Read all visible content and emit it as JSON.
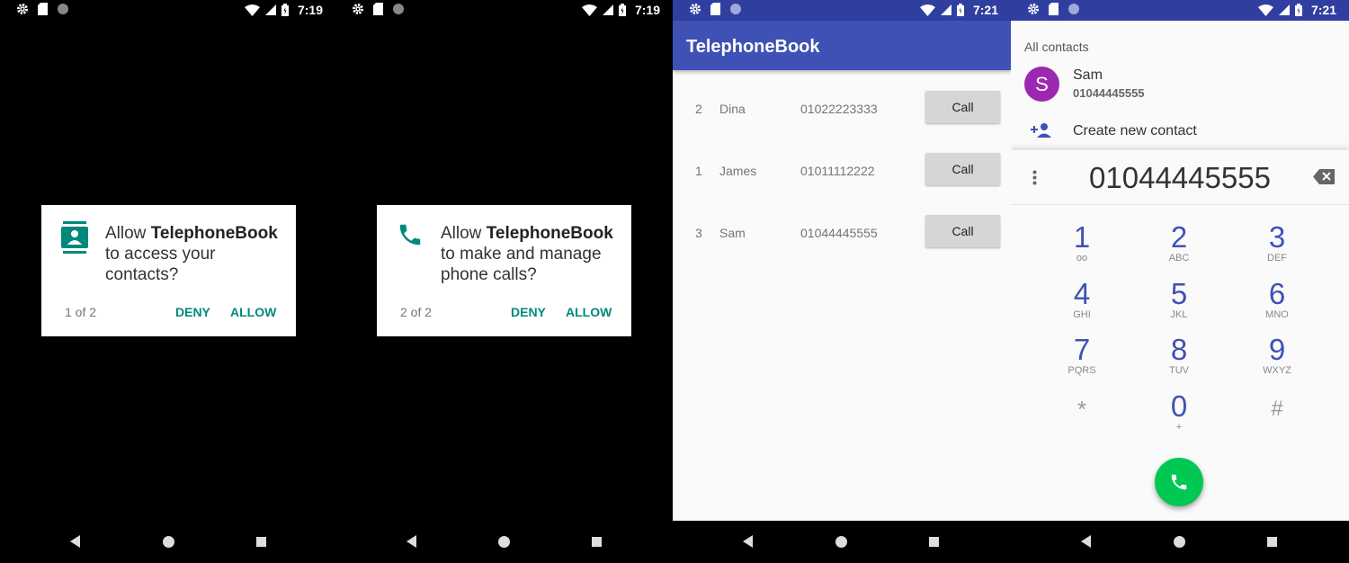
{
  "screen1": {
    "status_time": "7:19",
    "dialog": {
      "line1_prefix": "Allow ",
      "app_name": "TelephoneBook",
      "line2": "to access your",
      "line3": "contacts?",
      "counter": "1 of 2",
      "deny_label": "DENY",
      "allow_label": "ALLOW",
      "icon": "contacts-icon"
    }
  },
  "screen2": {
    "status_time": "7:19",
    "dialog": {
      "line1_prefix": "Allow ",
      "app_name": "TelephoneBook",
      "line2": "to make and manage",
      "line3": "phone calls?",
      "counter": "2 of 2",
      "deny_label": "DENY",
      "allow_label": "ALLOW",
      "icon": "phone-icon"
    }
  },
  "screen3": {
    "status_time": "7:21",
    "app_title": "TelephoneBook",
    "contacts": [
      {
        "index": "2",
        "name": "Dina",
        "number": "01022223333",
        "button": "Call"
      },
      {
        "index": "1",
        "name": "James",
        "number": "01011112222",
        "button": "Call"
      },
      {
        "index": "3",
        "name": "Sam",
        "number": "01044445555",
        "button": "Call"
      }
    ]
  },
  "screen4": {
    "status_time": "7:21",
    "section_header": "All contacts",
    "contact": {
      "initial": "S",
      "name": "Sam",
      "number": "01044445555"
    },
    "create_label": "Create new contact",
    "dialed_number": "01044445555",
    "keys": [
      {
        "digit": "1",
        "letters": "oo"
      },
      {
        "digit": "2",
        "letters": "ABC"
      },
      {
        "digit": "3",
        "letters": "DEF"
      },
      {
        "digit": "4",
        "letters": "GHI"
      },
      {
        "digit": "5",
        "letters": "JKL"
      },
      {
        "digit": "6",
        "letters": "MNO"
      },
      {
        "digit": "7",
        "letters": "PQRS"
      },
      {
        "digit": "8",
        "letters": "TUV"
      },
      {
        "digit": "9",
        "letters": "WXYZ"
      },
      {
        "digit": "*",
        "letters": ""
      },
      {
        "digit": "0",
        "letters": "+"
      },
      {
        "digit": "#",
        "letters": ""
      }
    ]
  },
  "colors": {
    "accent_teal": "#00897b",
    "appbar": "#3f51b5",
    "statusbar_app": "#303f9f",
    "avatar": "#9c27b0",
    "call_fab": "#00c853"
  }
}
